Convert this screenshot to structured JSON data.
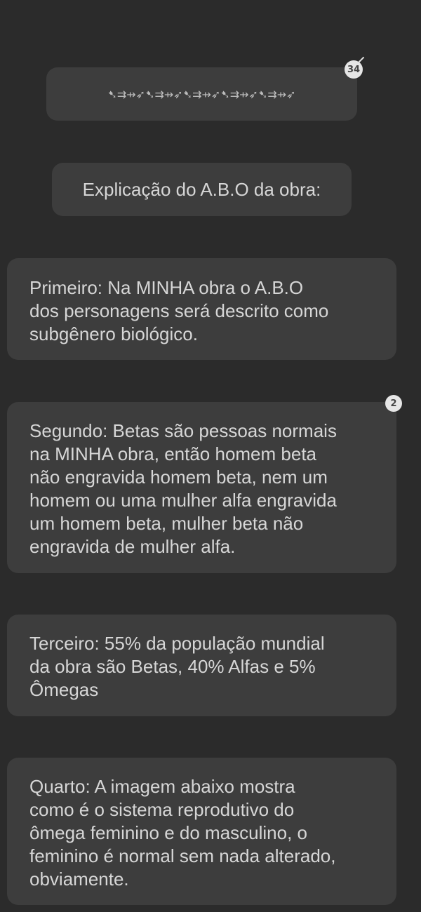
{
  "decoration": {
    "text": "➷⇉⇸➶➷⇉⇸➶➷⇉⇸➶➷⇉⇸➶➷⇉⇸➶"
  },
  "title": {
    "text": "Explicação do A.B.O da obra:"
  },
  "cards": [
    {
      "text": "Primeiro: Na MINHA obra o A.B.O\ndos personagens será descrito como\nsubgênero biológico."
    },
    {
      "text": "Segundo: Betas são pessoas normais\nna MINHA obra, então homem beta\nnão engravida homem beta, nem um\nhomem ou uma mulher alfa engravida\num homem beta, mulher beta não\nengravida de mulher alfa."
    },
    {
      "text": "Terceiro: 55% da população mundial\nda obra são Betas, 40% Alfas e 5%\nÔmegas"
    },
    {
      "text": "Quarto: A imagem abaixo mostra\ncomo é o sistema reprodutivo do\nômega feminino e do masculino, o\nfeminino é normal sem nada alterado,\nobviamente."
    }
  ],
  "badges": {
    "comment_count_1": "34",
    "comment_count_2": "2"
  }
}
